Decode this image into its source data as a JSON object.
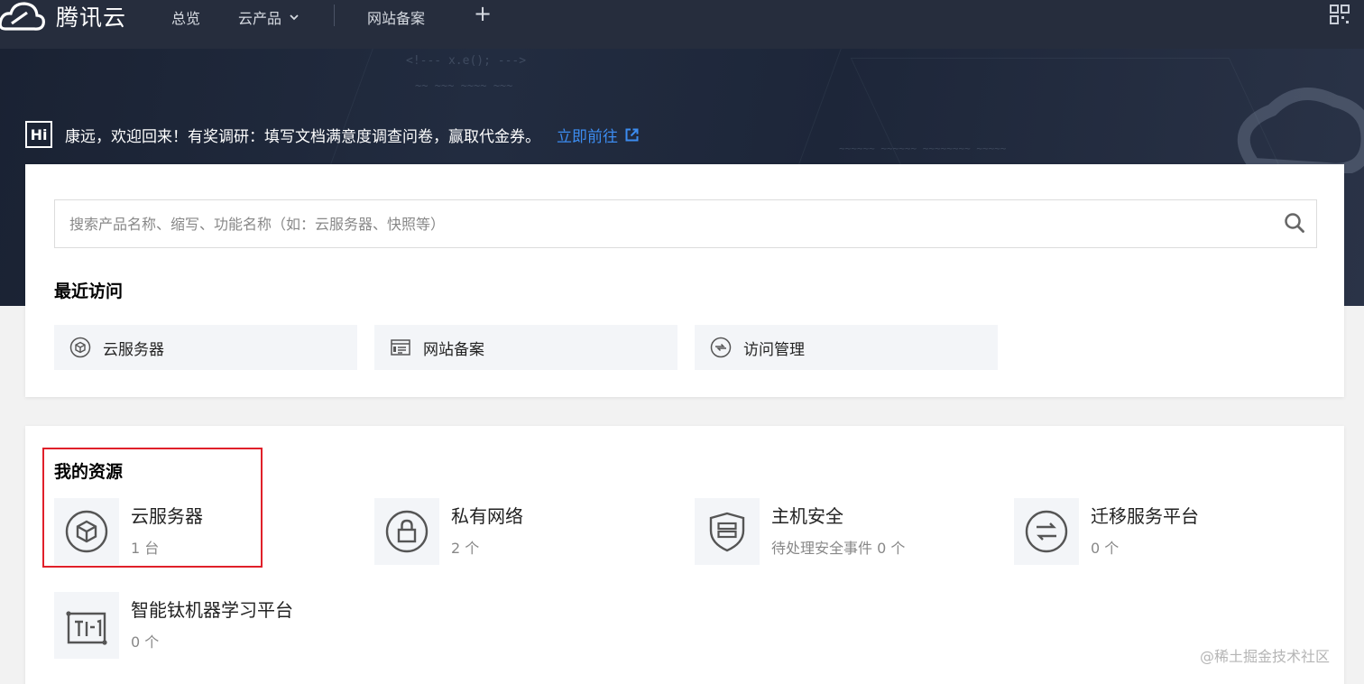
{
  "brand": {
    "name": "腾讯云"
  },
  "nav": {
    "items": [
      {
        "label": "总览"
      },
      {
        "label": "云产品"
      },
      {
        "label": "网站备案"
      }
    ],
    "plus": "+"
  },
  "banner": {
    "badge": "Hi",
    "greeting": "康远，欢迎回来！有奖调研：填写文档满意度调查问卷，赢取代金券。",
    "link": "立即前往"
  },
  "search": {
    "placeholder": "搜索产品名称、缩写、功能名称（如：云服务器、快照等）"
  },
  "recent": {
    "title": "最近访问",
    "items": [
      {
        "label": "云服务器",
        "icon": "cube-icon"
      },
      {
        "label": "网站备案",
        "icon": "document-icon"
      },
      {
        "label": "访问管理",
        "icon": "access-icon"
      }
    ]
  },
  "resources": {
    "title": "我的资源",
    "items": [
      {
        "name": "云服务器",
        "count": "1 台",
        "icon": "cube-icon"
      },
      {
        "name": "私有网络",
        "count": "2 个",
        "icon": "lock-icon"
      },
      {
        "name": "主机安全",
        "count": "待处理安全事件 0 个",
        "icon": "shield-icon"
      },
      {
        "name": "迁移服务平台",
        "count": "0 个",
        "icon": "migrate-icon"
      },
      {
        "name": "智能钛机器学习平台",
        "count": "0 个",
        "icon": "ti-one-icon"
      }
    ]
  },
  "watermark": "@稀土掘金技术社区",
  "colors": {
    "nav_bg": "#262d3d",
    "link": "#3c8cf0",
    "highlight": "#e0202a",
    "tile_bg": "#f3f5f8"
  }
}
